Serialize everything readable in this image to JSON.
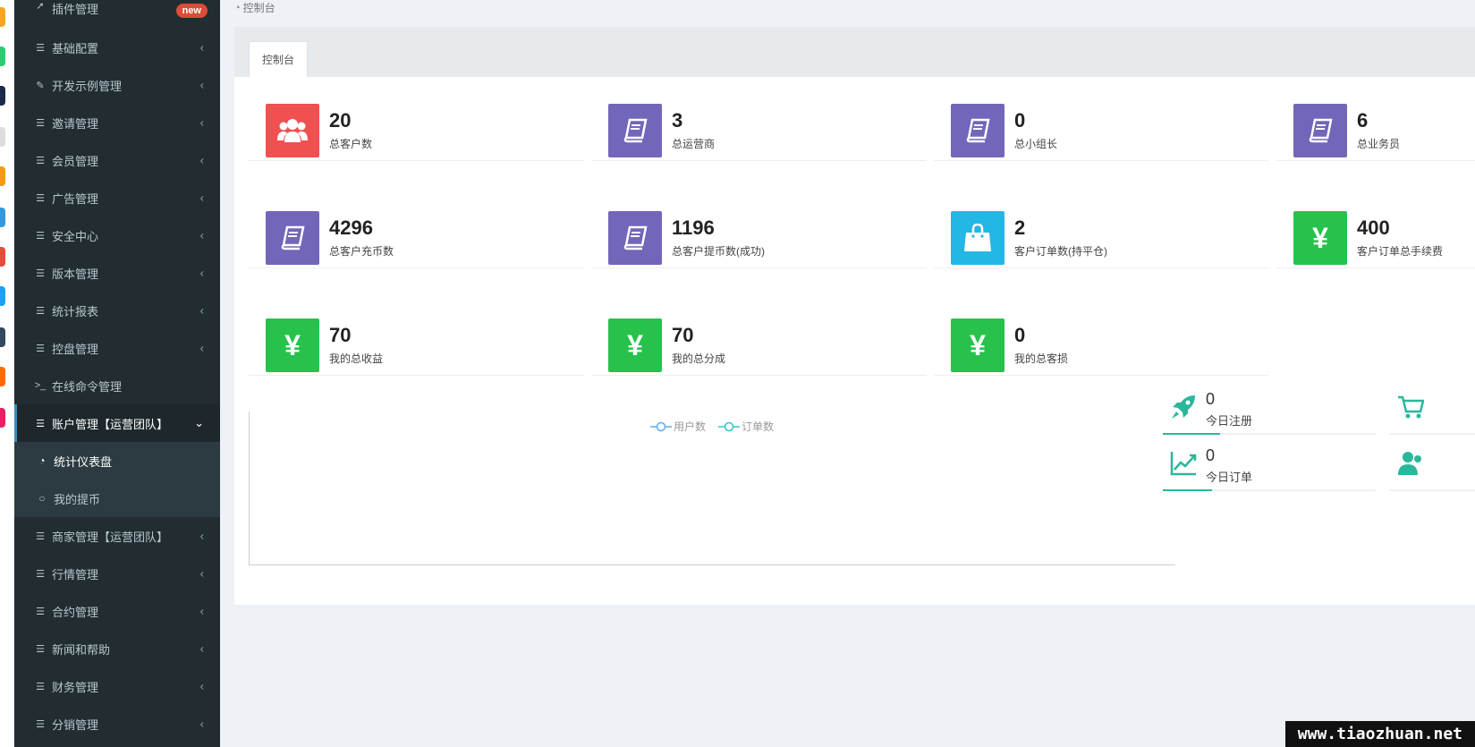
{
  "sidebar": {
    "items": [
      {
        "label": "插件管理",
        "icon": "rocket-icon",
        "badge": "new"
      },
      {
        "label": "基础配置",
        "icon": "list-icon"
      },
      {
        "label": "开发示例管理",
        "icon": "magic-icon"
      },
      {
        "label": "邀请管理",
        "icon": "list-icon"
      },
      {
        "label": "会员管理",
        "icon": "list-icon"
      },
      {
        "label": "广告管理",
        "icon": "list-icon"
      },
      {
        "label": "安全中心",
        "icon": "list-icon"
      },
      {
        "label": "版本管理",
        "icon": "list-icon"
      },
      {
        "label": "统计报表",
        "icon": "list-icon"
      },
      {
        "label": "控盘管理",
        "icon": "list-icon"
      },
      {
        "label": "在线命令管理",
        "icon": "terminal-icon"
      },
      {
        "label": "账户管理【运营团队】",
        "icon": "list-icon"
      },
      {
        "label": "商家管理【运营团队】",
        "icon": "list-icon"
      },
      {
        "label": "行情管理",
        "icon": "list-icon"
      },
      {
        "label": "合约管理",
        "icon": "list-icon"
      },
      {
        "label": "新闻和帮助",
        "icon": "list-icon"
      },
      {
        "label": "财务管理",
        "icon": "list-icon"
      },
      {
        "label": "分销管理",
        "icon": "list-icon"
      }
    ],
    "subitems": [
      {
        "label": "统计仪表盘",
        "icon": "dashboard-icon"
      },
      {
        "label": "我的提币",
        "icon": "circle-icon"
      }
    ]
  },
  "breadcrumb": {
    "label": "控制台"
  },
  "tab": {
    "label": "控制台"
  },
  "stats": [
    {
      "value": "20",
      "label": "总客户数",
      "icon": "users-icon",
      "color": "#f05050"
    },
    {
      "value": "3",
      "label": "总运营商",
      "icon": "book-icon",
      "color": "#7266ba"
    },
    {
      "value": "0",
      "label": "总小组长",
      "icon": "book-icon",
      "color": "#7266ba"
    },
    {
      "value": "6",
      "label": "总业务员",
      "icon": "book-icon",
      "color": "#7266ba"
    },
    {
      "value": "4296",
      "label": "总客户充币数",
      "icon": "book-icon",
      "color": "#7266ba"
    },
    {
      "value": "1196",
      "label": "总客户提币数(成功)",
      "icon": "book-icon",
      "color": "#7266ba"
    },
    {
      "value": "2",
      "label": "客户订单数(持平仓)",
      "icon": "shopping-bag-icon",
      "color": "#23b7e5"
    },
    {
      "value": "400",
      "label": "客户订单总手续费",
      "icon": "yen-icon",
      "color": "#27c24c"
    },
    {
      "value": "70",
      "label": "我的总收益",
      "icon": "yen-icon",
      "color": "#27c24c"
    },
    {
      "value": "70",
      "label": "我的总分成",
      "icon": "yen-icon",
      "color": "#27c24c"
    },
    {
      "value": "0",
      "label": "我的总客损",
      "icon": "yen-icon",
      "color": "#27c24c"
    }
  ],
  "chart": {
    "legend": [
      "用户数",
      "订单数"
    ]
  },
  "today": [
    {
      "value": "0",
      "label": "今日注册",
      "icon": "rocket-icon",
      "progress": 0.27
    },
    {
      "value": "0",
      "label": "今日订单",
      "icon": "line-chart-icon",
      "progress": 0.23
    }
  ],
  "yen_symbol": "¥",
  "watermark": "www.tiaozhuan.net"
}
